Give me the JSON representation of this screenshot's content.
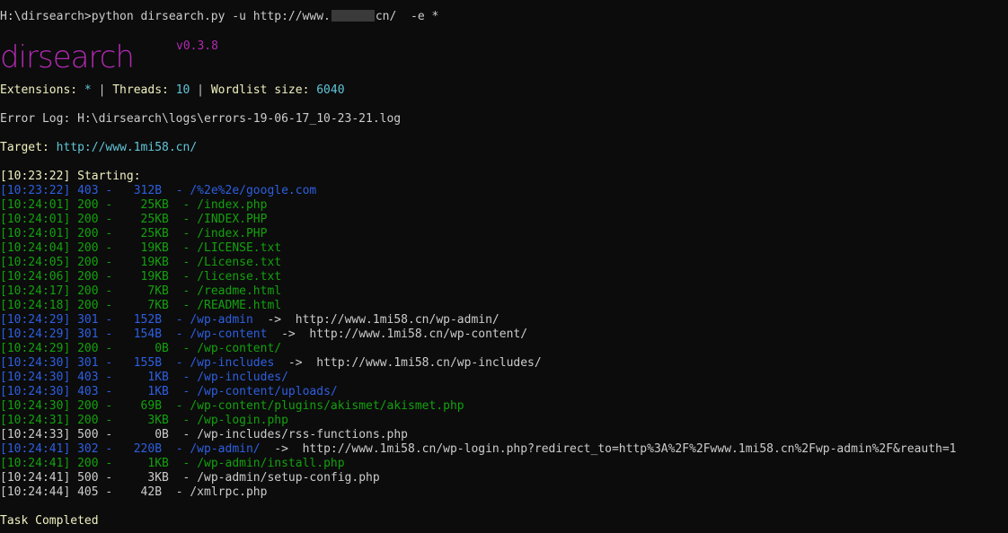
{
  "prompt": {
    "before_redaction": "H:\\dirsearch>python dirsearch.py -u http://www.",
    "after_redaction": "cn/  -e *"
  },
  "logo": {
    "text": "dirsearch",
    "version": "v0.3.8",
    "color": "#b02ab0"
  },
  "info": {
    "extensions_label": "Extensions: ",
    "extensions_value": "*",
    "sep1": " | ",
    "threads_label": "Threads: ",
    "threads_value": "10",
    "sep2": " | ",
    "wordlist_label": "Wordlist size: ",
    "wordlist_value": "6040"
  },
  "error_log": "Error Log: H:\\dirsearch\\logs\\errors-19-06-17_10-23-21.log",
  "target": {
    "label": "Target: ",
    "url": "http://www.1mi58.cn/"
  },
  "starting": "[10:23:22] Starting:",
  "results": [
    {
      "time": "[10:23:22]",
      "status": "403",
      "size": " 312B",
      "path": "/%2e%2e/google.com",
      "redirect": "",
      "color": "blue"
    },
    {
      "time": "[10:24:01]",
      "status": "200",
      "size": "  25KB",
      "path": "/index.php",
      "redirect": "",
      "color": "green"
    },
    {
      "time": "[10:24:01]",
      "status": "200",
      "size": "  25KB",
      "path": "/INDEX.PHP",
      "redirect": "",
      "color": "green"
    },
    {
      "time": "[10:24:01]",
      "status": "200",
      "size": "  25KB",
      "path": "/index.PHP",
      "redirect": "",
      "color": "green"
    },
    {
      "time": "[10:24:04]",
      "status": "200",
      "size": "  19KB",
      "path": "/LICENSE.txt",
      "redirect": "",
      "color": "green"
    },
    {
      "time": "[10:24:05]",
      "status": "200",
      "size": "  19KB",
      "path": "/License.txt",
      "redirect": "",
      "color": "green"
    },
    {
      "time": "[10:24:06]",
      "status": "200",
      "size": "  19KB",
      "path": "/license.txt",
      "redirect": "",
      "color": "green"
    },
    {
      "time": "[10:24:17]",
      "status": "200",
      "size": "   7KB",
      "path": "/readme.html",
      "redirect": "",
      "color": "green"
    },
    {
      "time": "[10:24:18]",
      "status": "200",
      "size": "   7KB",
      "path": "/README.html",
      "redirect": "",
      "color": "green"
    },
    {
      "time": "[10:24:29]",
      "status": "301",
      "size": " 152B",
      "path": "/wp-admin",
      "redirect": "http://www.1mi58.cn/wp-admin/",
      "color": "blue"
    },
    {
      "time": "[10:24:29]",
      "status": "301",
      "size": " 154B",
      "path": "/wp-content",
      "redirect": "http://www.1mi58.cn/wp-content/",
      "color": "blue"
    },
    {
      "time": "[10:24:29]",
      "status": "200",
      "size": "    0B",
      "path": "/wp-content/",
      "redirect": "",
      "color": "green"
    },
    {
      "time": "[10:24:30]",
      "status": "301",
      "size": " 155B",
      "path": "/wp-includes",
      "redirect": "http://www.1mi58.cn/wp-includes/",
      "color": "blue"
    },
    {
      "time": "[10:24:30]",
      "status": "403",
      "size": "   1KB",
      "path": "/wp-includes/",
      "redirect": "",
      "color": "blue"
    },
    {
      "time": "[10:24:30]",
      "status": "403",
      "size": "   1KB",
      "path": "/wp-content/uploads/",
      "redirect": "",
      "color": "blue"
    },
    {
      "time": "[10:24:30]",
      "status": "200",
      "size": "  69B",
      "path": "/wp-content/plugins/akismet/akismet.php",
      "redirect": "",
      "color": "green"
    },
    {
      "time": "[10:24:31]",
      "status": "200",
      "size": "   3KB",
      "path": "/wp-login.php",
      "redirect": "",
      "color": "green"
    },
    {
      "time": "[10:24:33]",
      "status": "500",
      "size": "    0B",
      "path": "/wp-includes/rss-functions.php",
      "redirect": "",
      "color": "default"
    },
    {
      "time": "[10:24:41]",
      "status": "302",
      "size": " 220B",
      "path": "/wp-admin/",
      "redirect": "http://www.1mi58.cn/wp-login.php?redirect_to=http%3A%2F%2Fwww.1mi58.cn%2Fwp-admin%2F&reauth=1",
      "color": "blue"
    },
    {
      "time": "[10:24:41]",
      "status": "200",
      "size": "   1KB",
      "path": "/wp-admin/install.php",
      "redirect": "",
      "color": "green"
    },
    {
      "time": "[10:24:41]",
      "status": "500",
      "size": "   3KB",
      "path": "/wp-admin/setup-config.php",
      "redirect": "",
      "color": "default"
    },
    {
      "time": "[10:24:44]",
      "status": "405",
      "size": "  42B",
      "path": "/xmlrpc.php",
      "redirect": "",
      "color": "default"
    }
  ],
  "task_completed": "Task Completed"
}
